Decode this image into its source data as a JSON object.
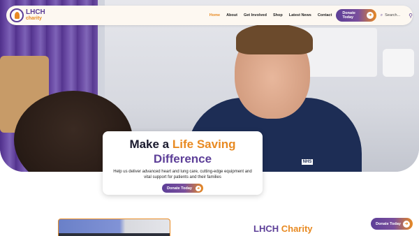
{
  "brand": {
    "title": "LHCH",
    "subtitle": "charity"
  },
  "nav": {
    "items": [
      {
        "label": "Home",
        "active": true
      },
      {
        "label": "About",
        "active": false
      },
      {
        "label": "Get Involved",
        "active": false
      },
      {
        "label": "Shop",
        "active": false
      },
      {
        "label": "Latest News",
        "active": false
      },
      {
        "label": "Contact",
        "active": false
      }
    ],
    "donate_label": "Donate Today",
    "search_placeholder": "Search..."
  },
  "hero": {
    "title_part1": "Make a ",
    "title_highlight": "Life Saving",
    "title_line2": "Difference",
    "description": "Help us deliver advanced heart and lung care, cutting-edge equipment and vital support for patients and their families",
    "donate_label": "Donate Today",
    "badge_text": "NHS"
  },
  "section": {
    "title_part1": "LHCH",
    "title_part2": "Charity"
  },
  "floating": {
    "donate_label": "Donate Today"
  },
  "icons": {
    "arrow": "arrow-right-icon",
    "search": "search-icon"
  },
  "colors": {
    "brand_purple": "#5d3f98",
    "brand_orange": "#e88a22",
    "nav_background": "#fdf8f1"
  }
}
